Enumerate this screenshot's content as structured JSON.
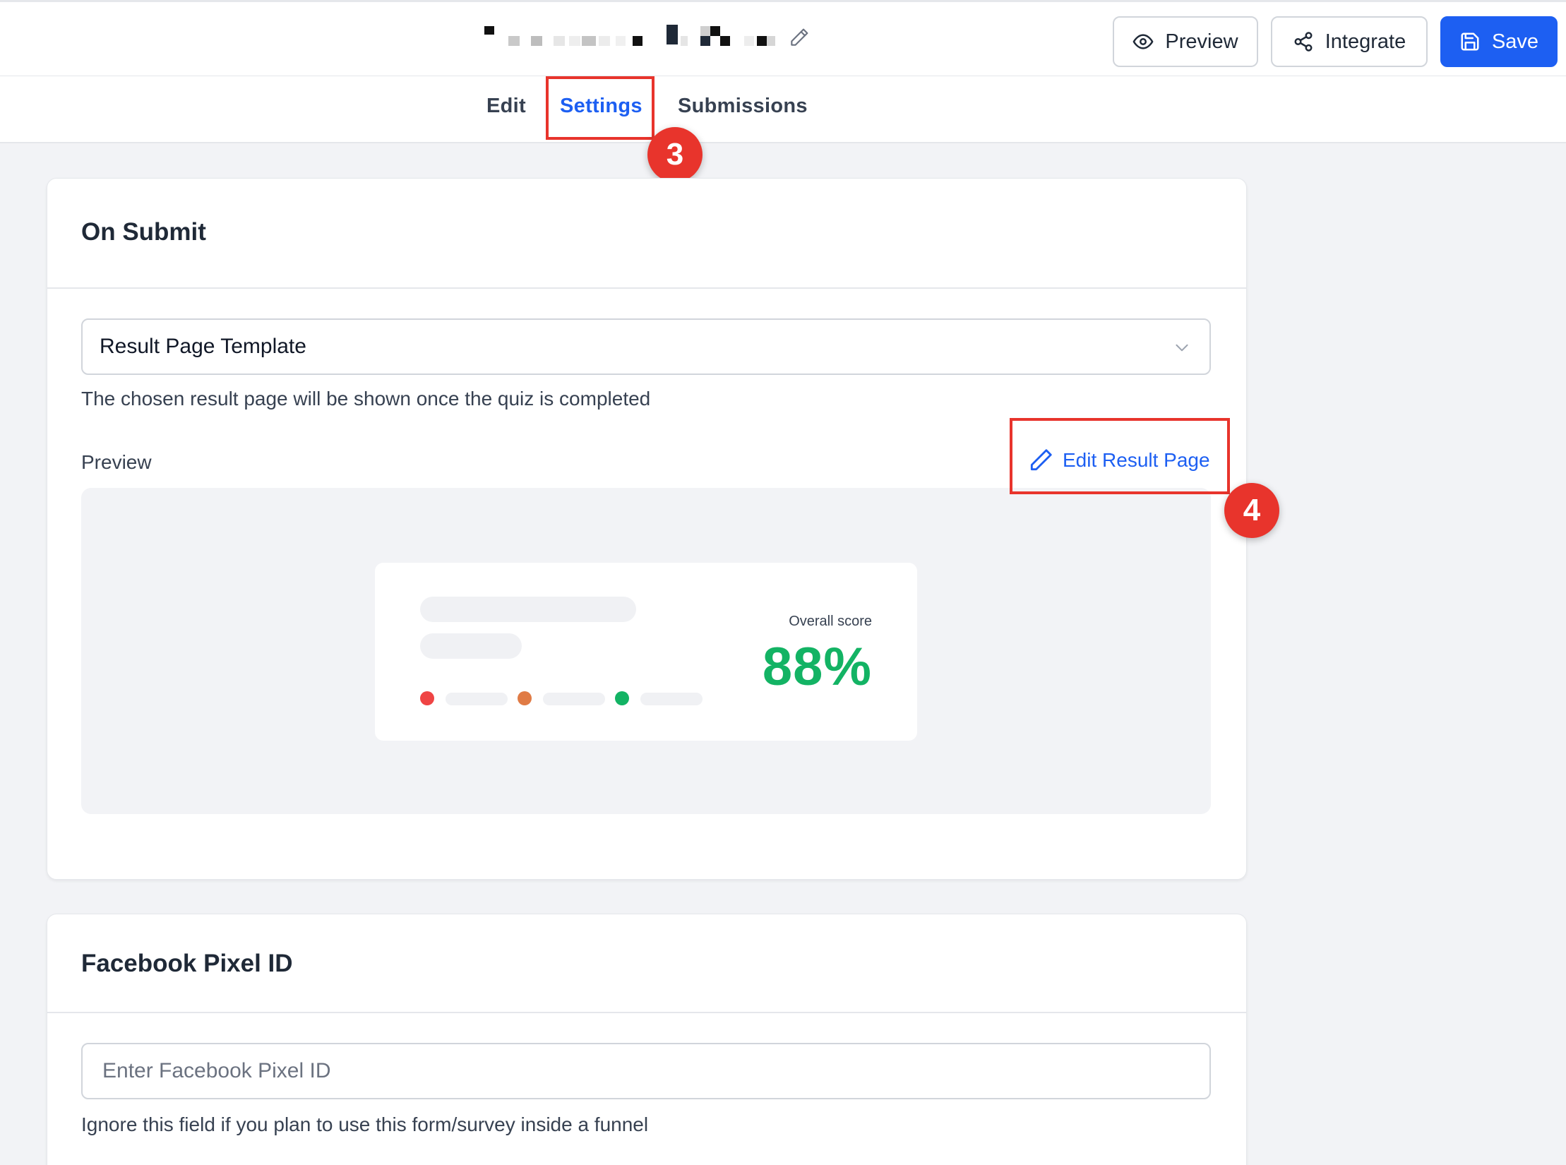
{
  "header": {
    "form_title": "",
    "buttons": {
      "preview": "Preview",
      "integrate": "Integrate",
      "save": "Save"
    }
  },
  "tabs": [
    {
      "label": "Edit"
    },
    {
      "label": "Settings",
      "active": true
    },
    {
      "label": "Submissions"
    }
  ],
  "annotations": {
    "step_settings": "3",
    "step_edit_result": "4"
  },
  "on_submit": {
    "title": "On Submit",
    "select_value": "Result Page Template",
    "help": "The chosen result page will be shown once the quiz is completed",
    "preview_label": "Preview",
    "edit_link": "Edit Result Page",
    "preview_card": {
      "score_label": "Overall score",
      "score": "88%"
    }
  },
  "facebook": {
    "title": "Facebook Pixel ID",
    "placeholder": "Enter Facebook Pixel ID",
    "value": "",
    "help": "Ignore this field if you plan to use this form/survey inside a funnel"
  },
  "colors": {
    "accent": "#1d5ff2",
    "annotation_red": "#e8342c",
    "score_green": "#13b364",
    "dot_red": "#ef4444",
    "dot_orange": "#e07b45",
    "dot_green": "#13b364"
  },
  "icons": {
    "title_edit": "pencil-icon",
    "preview": "eye-icon",
    "integrate": "share-icon",
    "save": "floppy-disk-icon",
    "select": "chevron-down-icon",
    "edit_link": "pencil-icon"
  }
}
